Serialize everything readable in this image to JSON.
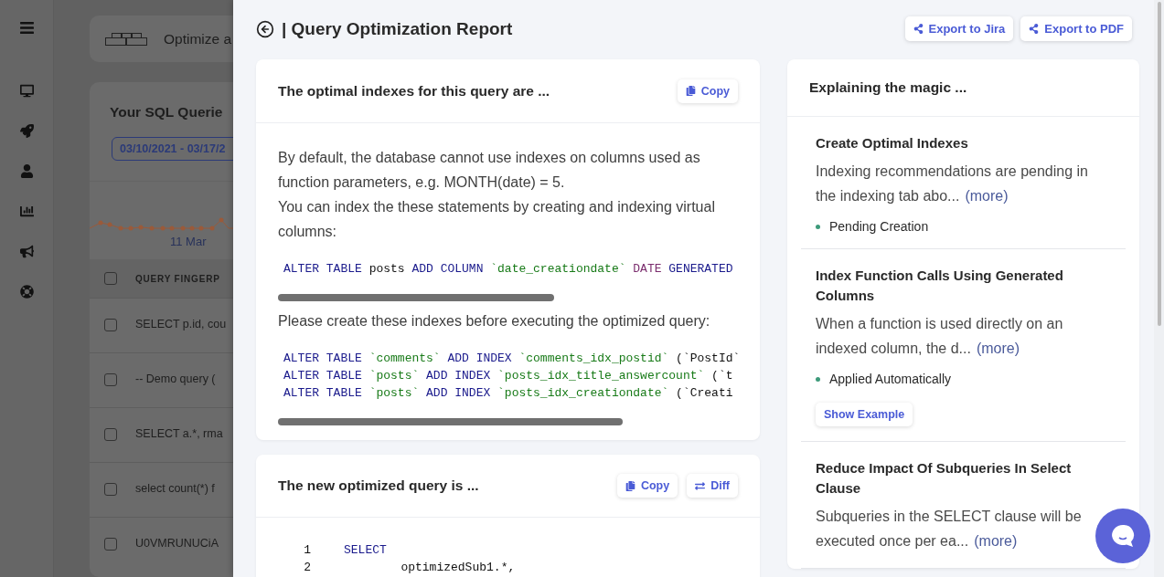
{
  "background": {
    "toolbar_text": "Optimize a",
    "section_title": "Your SQL Querie",
    "date_range": "03/10/2021 - 03/17/2",
    "chart_label": "11 Mar",
    "table": {
      "header_checked": false,
      "columns": [
        "QUERY FINGERP"
      ],
      "rows": [
        {
          "checked": false,
          "text": "SELECT p.id, cou"
        },
        {
          "checked": false,
          "text": "-- Demo query ("
        },
        {
          "checked": false,
          "text": "SELECT a.*, rma"
        },
        {
          "checked": false,
          "text": "select count(*) f"
        },
        {
          "checked": false,
          "text": "U0VMRUNUCiA"
        }
      ]
    }
  },
  "report": {
    "title": "| Query Optimization Report",
    "actions": [
      {
        "label": "Export to Jira"
      },
      {
        "label": "Export to PDF"
      }
    ]
  },
  "indexes_card": {
    "title": "The optimal indexes for this query are ...",
    "actions": [
      {
        "kind": "copy",
        "label": "Copy"
      }
    ],
    "body": [
      {
        "kind": "text",
        "text": "By default, the database cannot use indexes on columns used as function parameters, e.g. MONTH(date) = 5."
      },
      {
        "kind": "text",
        "text": "You can index the these statements by creating and indexing virtual columns:"
      },
      {
        "kind": "code",
        "lines": [
          [
            {
              "kind": "keyword",
              "text": "ALTER TABLE "
            },
            {
              "kind": "plain",
              "text": "posts "
            },
            {
              "kind": "keyword",
              "text": "ADD COLUMN "
            },
            {
              "kind": "string",
              "text": "`date_creationdate` "
            },
            {
              "kind": "type",
              "text": "DATE "
            },
            {
              "kind": "keyword",
              "text": "GENERATED"
            }
          ]
        ]
      },
      {
        "kind": "text",
        "text": "Please create these indexes before executing the optimized query:"
      },
      {
        "kind": "code",
        "lines": [
          [
            {
              "kind": "keyword",
              "text": "ALTER TABLE "
            },
            {
              "kind": "string",
              "text": "`comments` "
            },
            {
              "kind": "keyword",
              "text": "ADD INDEX "
            },
            {
              "kind": "string",
              "text": "`comments_idx_postid` "
            },
            {
              "kind": "plain",
              "text": "(`PostId`"
            }
          ],
          [
            {
              "kind": "keyword",
              "text": "ALTER TABLE "
            },
            {
              "kind": "string",
              "text": "`posts` "
            },
            {
              "kind": "keyword",
              "text": "ADD INDEX "
            },
            {
              "kind": "string",
              "text": "`posts_idx_title_answercount` "
            },
            {
              "kind": "plain",
              "text": "(`t"
            }
          ],
          [
            {
              "kind": "keyword",
              "text": "ALTER TABLE "
            },
            {
              "kind": "string",
              "text": "`posts` "
            },
            {
              "kind": "keyword",
              "text": "ADD INDEX "
            },
            {
              "kind": "string",
              "text": "`posts_idx_creationdate` "
            },
            {
              "kind": "plain",
              "text": "(`Creati"
            }
          ]
        ]
      }
    ]
  },
  "query_card": {
    "title": "The new optimized query is ...",
    "actions": [
      {
        "kind": "copy",
        "label": "Copy"
      },
      {
        "kind": "diff",
        "label": "Diff"
      }
    ],
    "lines": [
      {
        "number": "1",
        "tokens": [
          {
            "kind": "keyword",
            "text": "SELECT"
          }
        ]
      },
      {
        "number": "2",
        "tokens": [
          {
            "kind": "plain",
            "text": "        optimizedSub1.*,"
          }
        ]
      }
    ]
  },
  "explain_card": {
    "title": "Explaining the magic ...",
    "items": [
      {
        "title": "Create Optimal Indexes",
        "description": "Indexing recommendations are pending in the indexing tab abo...",
        "more": "(more)",
        "status": "Pending Creation"
      },
      {
        "title": "Index Function Calls Using Generated Columns",
        "description": "When a function is used directly on an indexed column, the d...",
        "more": "(more)",
        "status": "Applied Automatically",
        "action": "Show Example"
      },
      {
        "title": "Reduce Impact Of Subqueries In Select Clause",
        "description": "Subqueries in the SELECT clause will be executed once per ea...",
        "more": "(more)"
      }
    ]
  }
}
